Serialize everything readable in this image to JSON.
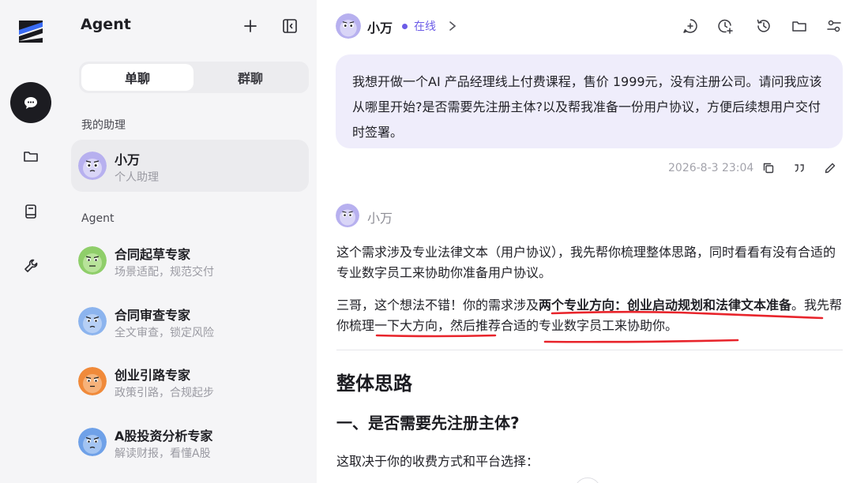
{
  "colors": {
    "accent": "#6c5ce7",
    "annotation": "#e8242b",
    "bubble": "#efedfb",
    "rail_active": "#1c1c21"
  },
  "rail": {
    "items": [
      {
        "icon": "chat-bubble-icon",
        "active": true
      },
      {
        "icon": "folder-icon"
      },
      {
        "icon": "book-icon"
      },
      {
        "icon": "wrench-icon"
      }
    ]
  },
  "sidebar": {
    "title": "Agent",
    "tabs": [
      {
        "label": "单聊",
        "active": true
      },
      {
        "label": "群聊"
      }
    ],
    "sections": [
      {
        "label": "我的助理",
        "items": [
          {
            "name": "小万",
            "sub": "个人助理",
            "selected": true
          }
        ]
      },
      {
        "label": "Agent",
        "items": [
          {
            "name": "合同起草专家",
            "sub": "场景适配，规范交付"
          },
          {
            "name": "合同审查专家",
            "sub": "全文审查，锁定风险"
          },
          {
            "name": "创业引路专家",
            "sub": "政策引路，合规起步"
          },
          {
            "name": "A股投资分析专家",
            "sub": "解读财报，看懂A股"
          }
        ]
      }
    ]
  },
  "header": {
    "name": "小万",
    "status": "在线",
    "tools": [
      "add-chat-icon",
      "clock-plus-icon",
      "history-icon",
      "folder-icon",
      "settings-sliders-icon"
    ]
  },
  "messages": {
    "user": {
      "text": "我想开做一个AI 产品经理线上付费课程，售价 1999元，没有注册公司。请问我应该从哪里开始?是否需要先注册主体?以及帮我准备一份用户协议，方便后续想用户交付时签署。",
      "time": "2026-8-3 23:04"
    },
    "bot": {
      "name": "小万",
      "p1": "这个需求涉及专业法律文本（用户协议），我先帮你梳理整体思路，同时看看有没有合适的专业数字员工来协助你准备用户协议。",
      "p2_a": "三哥，这个想法不错！你的需求涉及",
      "p2_b": "两个专业方向：创业启动规划和法律文本准备",
      "p2_c": "。我先帮你梳理一下大方向，然后推荐合适的专业数字员工来协助你。",
      "h2": "整体思路",
      "h3": "一、是否需要先注册主体?",
      "p3": "这取决于你的收费方式和平台选择："
    }
  }
}
